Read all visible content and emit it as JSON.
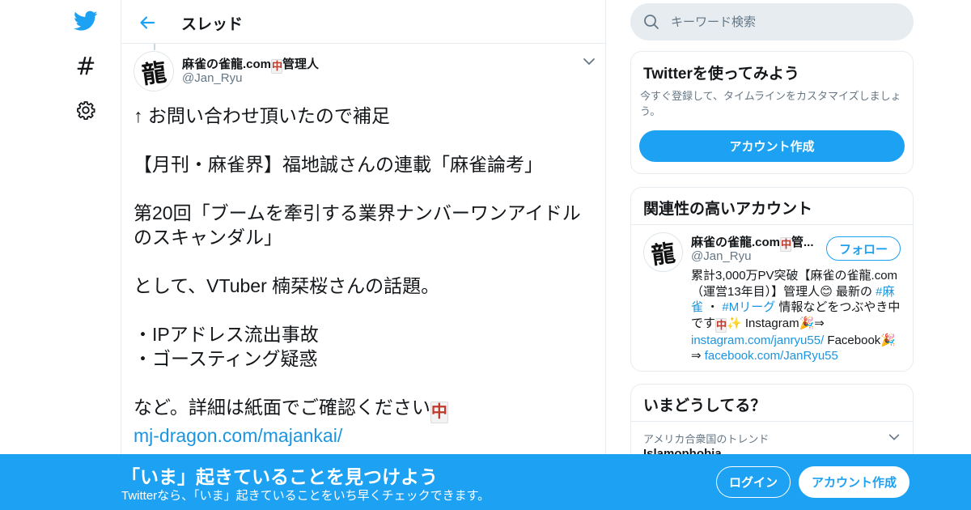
{
  "nav": {
    "icons": [
      "twitter-bird-icon",
      "hashtag-icon",
      "gear-icon"
    ],
    "hashtag_glyph": "#"
  },
  "thread": {
    "title": "スレッド"
  },
  "tweet": {
    "author_name": "麻雀の雀龍.com",
    "author_suffix": "管理人",
    "tile_char": "中",
    "avatar_glyph": "龍",
    "handle": "@Jan_Ryu",
    "lines": [
      "↑ お問い合わせ頂いたので補足",
      "【月刊・麻雀界】福地誠さんの連載「麻雀論考」",
      "第20回「ブームを牽引する業界ナンバーワンアイドルのスキャンダル」",
      "として、VTuber 楠栞桜さんの話題。",
      "・IPアドレス流出事故",
      "・ゴースティング疑惑",
      "など。詳細は紙面でご確認ください"
    ],
    "link": "mj-dragon.com/majankai/"
  },
  "search": {
    "placeholder": "キーワード検索"
  },
  "try_twitter": {
    "title": "Twitterを使ってみよう",
    "description": "今すぐ登録して、タイムラインをカスタマイズしましょう。",
    "button": "アカウント作成"
  },
  "related": {
    "title": "関連性の高いアカウント",
    "name": "麻雀の雀龍.com",
    "name_suffix": "管...",
    "handle": "@Jan_Ryu",
    "follow": "フォロー",
    "bio_1": "累計3,000万PV突破【麻雀の雀龍.com（運営13年目）】管理人",
    "bio_2": " 最新の ",
    "hashtag_1": "#麻雀",
    "bio_3": " ・ ",
    "hashtag_2": "#Mリーグ",
    "bio_4": " 情報などをつぶやき中です",
    "bio_5": " Instagram",
    "bio_arrow": "⇒ ",
    "instagram_link": "instagram.com/janryu55/",
    "bio_6": " Facebook",
    "facebook_link": "facebook.com/JanRyu55"
  },
  "trends": {
    "title": "いまどうしてる？",
    "location": "アメリカ合衆国のトレンド",
    "item": "Islamophobia"
  },
  "banner": {
    "title": "「いま」起きていることを見つけよう",
    "subtitle": "Twitterなら、「いま」起きていることをいち早くチェックできます。",
    "login": "ログイン",
    "signup": "アカウント作成"
  },
  "colors": {
    "brand": "#1da1f2",
    "link": "#1b95e0",
    "secondary_text": "#657786",
    "border": "#e6ecf0"
  }
}
